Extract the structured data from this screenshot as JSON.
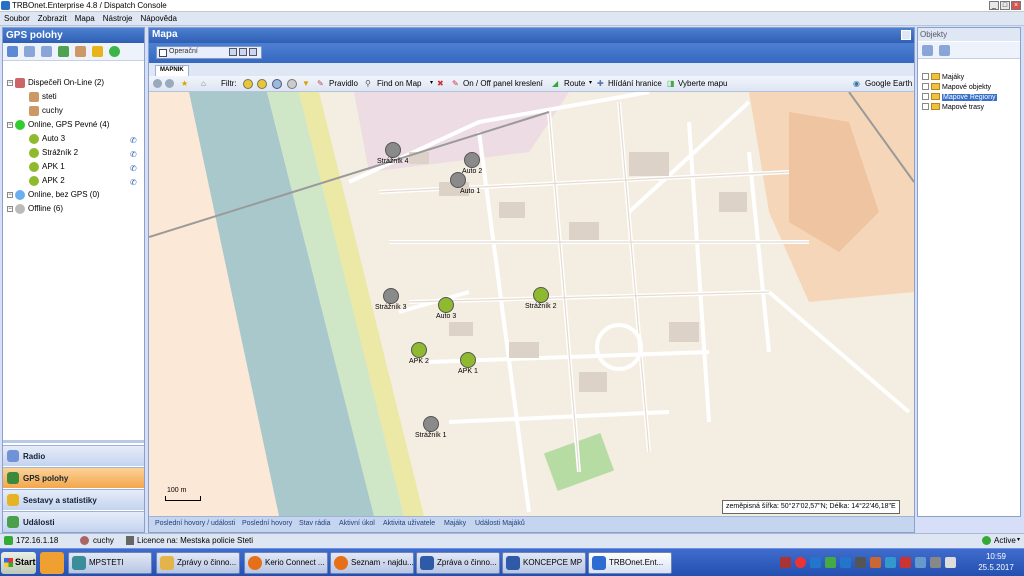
{
  "window": {
    "title": "TRBOnet.Enterprise 4.8 / Dispatch Console"
  },
  "menu": [
    "Soubor",
    "Zobrazit",
    "Mapa",
    "Nástroje",
    "Nápověda"
  ],
  "left_panel": {
    "title": "GPS polohy",
    "tree": [
      {
        "label": "Dispečeři On-Line (2)",
        "level": 0,
        "icon": "dispatcher-icon"
      },
      {
        "label": "steti",
        "level": 1,
        "icon": "user-icon"
      },
      {
        "label": "cuchy",
        "level": 1,
        "icon": "user-icon"
      },
      {
        "label": "Online, GPS Pevné (4)",
        "level": 0,
        "icon": "green-dot-icon"
      },
      {
        "label": "Auto 3",
        "level": 1,
        "icon": "car-icon",
        "phone": true
      },
      {
        "label": "Strážník 2",
        "level": 1,
        "icon": "walker-icon",
        "phone": true
      },
      {
        "label": "APK 1",
        "level": 1,
        "icon": "walker-icon",
        "phone": true
      },
      {
        "label": "APK 2",
        "level": 1,
        "icon": "walker-icon",
        "phone": true
      },
      {
        "label": "Online, bez GPS (0)",
        "level": 0,
        "icon": "blue-dot-icon"
      },
      {
        "label": "Offline (6)",
        "level": 0,
        "icon": "grey-dot-icon"
      }
    ],
    "nav": [
      {
        "label": "Radio",
        "active": false
      },
      {
        "label": "GPS polohy",
        "active": true
      },
      {
        "label": "Sestavy a statistiky",
        "active": false
      },
      {
        "label": "Události",
        "active": false
      }
    ]
  },
  "map_panel": {
    "title": "Mapa",
    "profile": "Operační",
    "tab": "MAPNIK",
    "toolbar": {
      "filter": "Filtr:",
      "ruler": "Pravidlo",
      "find": "Find on Map",
      "toggle": "On / Off panel kreslení",
      "route": "Route",
      "borders": "Hlídání hranice",
      "select_map": "Vyberte mapu",
      "google": "Google Earth"
    },
    "units": [
      {
        "label": "Strážník 4",
        "kind": "walker",
        "status": "offline"
      },
      {
        "label": "Auto 2",
        "kind": "car",
        "status": "offline"
      },
      {
        "label": "Auto 1",
        "kind": "car",
        "status": "offline"
      },
      {
        "label": "Strážník 3",
        "kind": "walker",
        "status": "offline"
      },
      {
        "label": "Auto 3",
        "kind": "car",
        "status": "online"
      },
      {
        "label": "Strážník 2",
        "kind": "walker",
        "status": "online"
      },
      {
        "label": "APK 2",
        "kind": "walker",
        "status": "online"
      },
      {
        "label": "APK 1",
        "kind": "walker",
        "status": "online"
      },
      {
        "label": "Strážník 1",
        "kind": "walker",
        "status": "offline"
      }
    ],
    "scale": "100 m",
    "coordinates": "zeměpisná šířka: 50°27'02,57\"N; Délka: 14°22'46,18\"E",
    "bottom_tabs": [
      "Poslední hovory / události",
      "Poslední hovory",
      "Stav rádia",
      "Aktivní úkol",
      "Aktivita uživatele",
      "Majáky",
      "Události Majáků"
    ]
  },
  "right_panel": {
    "title": "Objekty",
    "items": [
      {
        "label": "Majáky",
        "selected": false
      },
      {
        "label": "Mapové objekty",
        "selected": false
      },
      {
        "label": "Mapové Regiony",
        "selected": true
      },
      {
        "label": "Mapové trasy",
        "selected": false
      }
    ]
  },
  "status": {
    "ip": "172.16.1.18",
    "user": "cuchy",
    "license": "Licence na: Mestska policie Steti",
    "state": "Active"
  },
  "taskbar": {
    "start": "Start",
    "tasks": [
      "MPSTETI",
      "Zprávy o činno...",
      "Kerio Connect ...",
      "Seznam - najdu...",
      "Zpráva o činno...",
      "KONCEPCE MP ...",
      "TRBOnet.Ent..."
    ],
    "time": "10:59",
    "date": "25.5.2017"
  },
  "colors": {
    "accent": "#2e5fb4",
    "online": "#8fba2f",
    "offline": "#8a8a8a",
    "nav_active": "#f4a64a"
  }
}
